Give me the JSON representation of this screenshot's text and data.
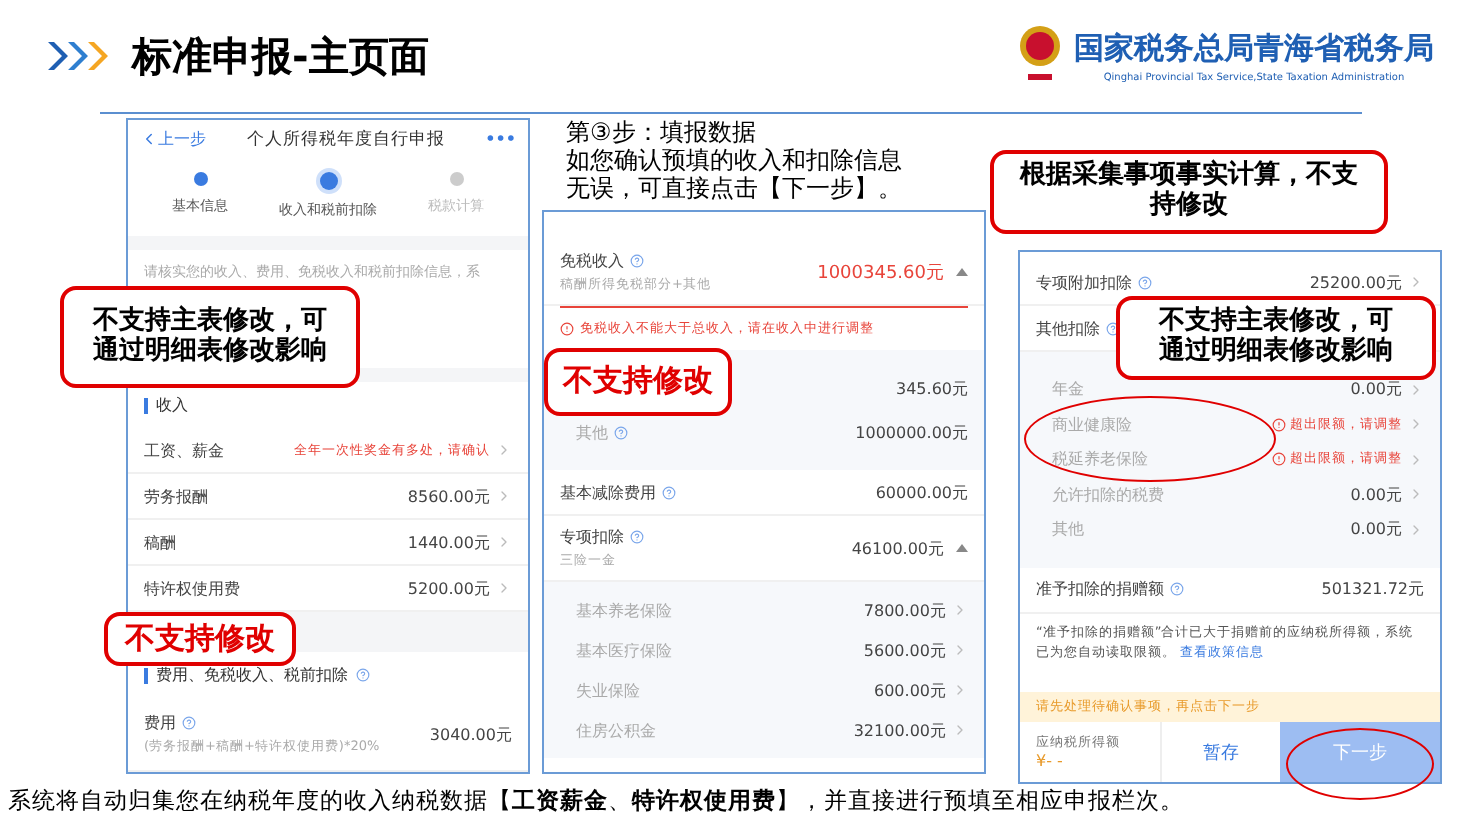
{
  "header": {
    "title": "标准申报-主页面",
    "org_name": "国家税务总局青海省税务局",
    "org_name_en": "Qinghai Provincial Tax Service,State Taxation Administration"
  },
  "left_phone": {
    "back": "上一步",
    "title": "个人所得税年度自行申报",
    "more": "•••",
    "steps": [
      {
        "label": "基本信息",
        "selected": false,
        "completed": true
      },
      {
        "label": "收入和税前扣除",
        "selected": true,
        "completed": true
      },
      {
        "label": "税款计算",
        "selected": false,
        "completed": false
      }
    ],
    "notice": "请核实您的收入、费用、免税收入和税前扣除信息，系",
    "income_title": "收入",
    "income_rows": [
      {
        "label": "工资、薪金",
        "warning": "全年一次性奖金有多处，请确认"
      },
      {
        "label": "劳务报酬",
        "value": "8560.00元"
      },
      {
        "label": "稿酬",
        "value": "1440.00元"
      },
      {
        "label": "特许权使用费",
        "value": "5200.00元"
      }
    ],
    "deduction_title": "费用、免税收入、税前扣除",
    "fee": {
      "label": "费用",
      "note": "(劳务报酬+稿酬+特许权使用费)*20%",
      "value": "3040.00元"
    }
  },
  "instructions": [
    "第③步：填报数据",
    "如您确认预填的收入和扣除信息",
    "无误，可直接点击【下一步】。"
  ],
  "middle_phone": {
    "rows": [
      {
        "kind": "expandable",
        "label": "免税收入",
        "help": true,
        "sub": "稿酬所得免税部分+其他",
        "value": "1000345.60元",
        "error": true,
        "expanded": true,
        "error_text": "免税收入不能大于总收入，请在收入中进行调整",
        "children": [
          {
            "value": "345.60元"
          },
          {
            "label": "其他",
            "help": true,
            "value": "1000000.00元"
          }
        ]
      },
      {
        "kind": "plain",
        "label": "基本减除费用",
        "help": true,
        "value": "60000.00元",
        "error": false
      },
      {
        "kind": "expandable",
        "label": "专项扣除",
        "help": true,
        "sub": "三险一金",
        "value": "46100.00元",
        "error": false,
        "expanded": true,
        "children": [
          {
            "label": "基本养老保险",
            "value": "7800.00元",
            "link": true
          },
          {
            "label": "基本医疗保险",
            "value": "5600.00元",
            "link": true
          },
          {
            "label": "失业保险",
            "value": "600.00元",
            "link": true
          },
          {
            "label": "住房公积金",
            "value": "32100.00元",
            "link": true
          }
        ]
      }
    ]
  },
  "right_phone": {
    "rows": [
      {
        "kind": "link",
        "label": "专项附加扣除",
        "help": true,
        "value": "25200.00元",
        "error": false
      },
      {
        "kind": "expandable",
        "label": "其他扣除",
        "help": true,
        "expanded": true,
        "children": [
          {
            "label": "年金",
            "value": "0.00元",
            "link": true
          },
          {
            "label": "商业健康险",
            "warning": "超出限额，请调整",
            "link": true
          },
          {
            "label": "税延养老保险",
            "warning": "超出限额，请调整",
            "link": true
          },
          {
            "label": "允许扣除的税费",
            "value": "0.00元",
            "link": true
          },
          {
            "label": "其他",
            "value": "0.00元",
            "link": true
          }
        ]
      },
      {
        "kind": "plain",
        "label": "准予扣除的捐赠额",
        "help": true,
        "value": "501321.72元",
        "error": false
      }
    ],
    "donation_note": "“准予扣除的捐赠额”合计已大于捐赠前的应纳税所得额，系统已为您自动读取限额。",
    "policy_link": "查看政策信息",
    "banner": "请先处理待确认事项，再点击下一步",
    "taxable_label": "应纳税所得额",
    "taxable_value": "¥- -",
    "save": "暂存",
    "next": {
      "label": "下一步",
      "disabled": true
    }
  },
  "callouts": [
    {
      "lines": [
        "不支持主表修改，可",
        "通过明细表修改影响"
      ],
      "color": "#000000"
    },
    {
      "lines": [
        "不支持修改"
      ],
      "color": "#e00000"
    },
    {
      "lines": [
        "不支持修改"
      ],
      "color": "#e00000"
    },
    {
      "lines": [
        "根据采集事项事实计算，不支",
        "持修改"
      ],
      "color": "#000000"
    },
    {
      "lines": [
        "不支持主表修改，可",
        "通过明细表修改影响"
      ],
      "color": "#000000"
    }
  ],
  "footer_text": "系统将自动归集您在纳税年度的收入纳税数据【**工资薪金**、**特许权使用费**】，并直接进行预填至相应申报栏次。"
}
